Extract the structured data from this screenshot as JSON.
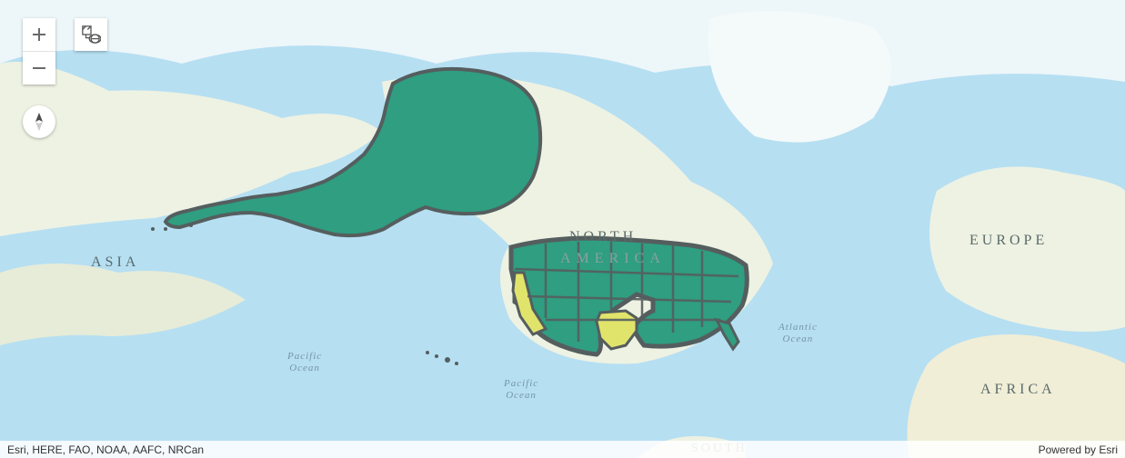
{
  "controls": {
    "zoom_in_title": "Zoom in",
    "zoom_out_title": "Zoom out",
    "basemap_title": "Basemap",
    "compass_title": "Reset orientation"
  },
  "labels": {
    "asia": "ASIA",
    "north": "NORTH",
    "america_overlay": "AMERICA",
    "europe": "EUROPE",
    "africa": "AFRICA",
    "south_cut": "SOUTH",
    "pacific1_l1": "Pacific",
    "pacific1_l2": "Ocean",
    "pacific2_l1": "Pacific",
    "pacific2_l2": "Ocean",
    "atlantic_l1": "Atlantic",
    "atlantic_l2": "Ocean"
  },
  "attribution": {
    "left": "Esri, HERE, FAO, NOAA, AAFC, NRCan",
    "right": "Powered by Esri"
  },
  "overlay": {
    "fill_main": "#2f9e81",
    "fill_alt": "#e1e46b",
    "stroke": "#555e5e"
  }
}
